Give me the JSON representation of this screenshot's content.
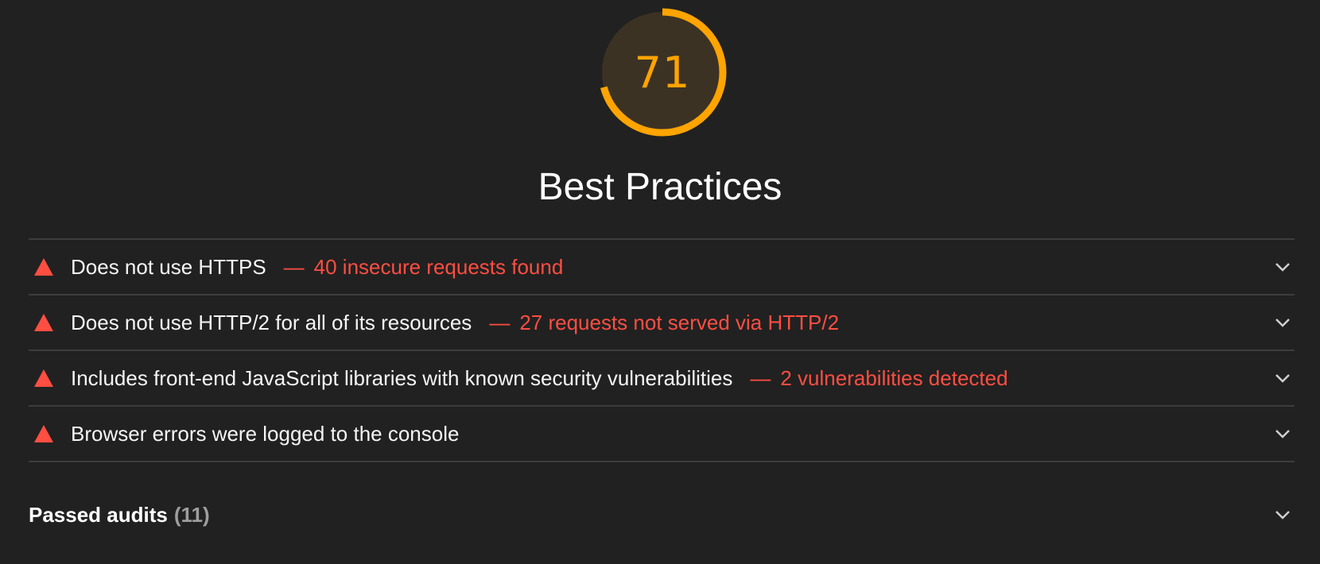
{
  "score": {
    "value": "71",
    "fraction": 0.71,
    "color": "#ffa400",
    "track_color": "#3c3224"
  },
  "category": {
    "title": "Best Practices"
  },
  "audits": [
    {
      "title": "Does not use HTTPS",
      "separator": "—",
      "display_value": "40 insecure requests found",
      "status_icon": "fail-triangle-icon"
    },
    {
      "title": "Does not use HTTP/2 for all of its resources",
      "separator": "—",
      "display_value": "27 requests not served via HTTP/2",
      "status_icon": "fail-triangle-icon"
    },
    {
      "title": "Includes front-end JavaScript libraries with known security vulnerabilities",
      "separator": "—",
      "display_value": "2 vulnerabilities detected",
      "status_icon": "fail-triangle-icon"
    },
    {
      "title": "Browser errors were logged to the console",
      "separator": "",
      "display_value": "",
      "status_icon": "fail-triangle-icon"
    }
  ],
  "passed": {
    "label": "Passed audits",
    "count": "11",
    "count_display": "(11)"
  },
  "colors": {
    "background": "#212121",
    "fail": "#ff4e42",
    "divider": "#3d3d3d",
    "average": "#ffa400"
  },
  "icons": {
    "fail": "fail-triangle-icon",
    "expand": "chevron-down-icon"
  }
}
